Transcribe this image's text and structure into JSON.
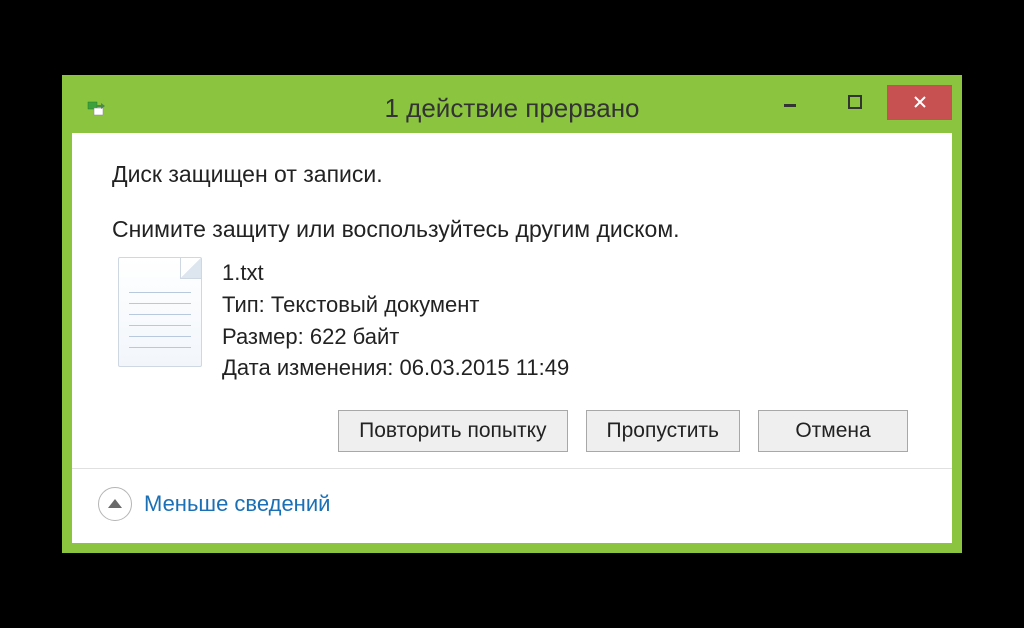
{
  "titlebar": {
    "title": "1 действие прервано"
  },
  "message": {
    "primary": "Диск защищен от записи.",
    "secondary": "Снимите защиту или воспользуйтесь другим диском."
  },
  "file": {
    "name": "1.txt",
    "type_label": "Тип:",
    "type_value": "Текстовый документ",
    "size_label": "Размер:",
    "size_value": "622 байт",
    "modified_label": "Дата изменения:",
    "modified_value": "06.03.2015 11:49"
  },
  "buttons": {
    "retry": "Повторить попытку",
    "skip": "Пропустить",
    "cancel": "Отмена"
  },
  "footer": {
    "less_details": "Меньше сведений"
  }
}
